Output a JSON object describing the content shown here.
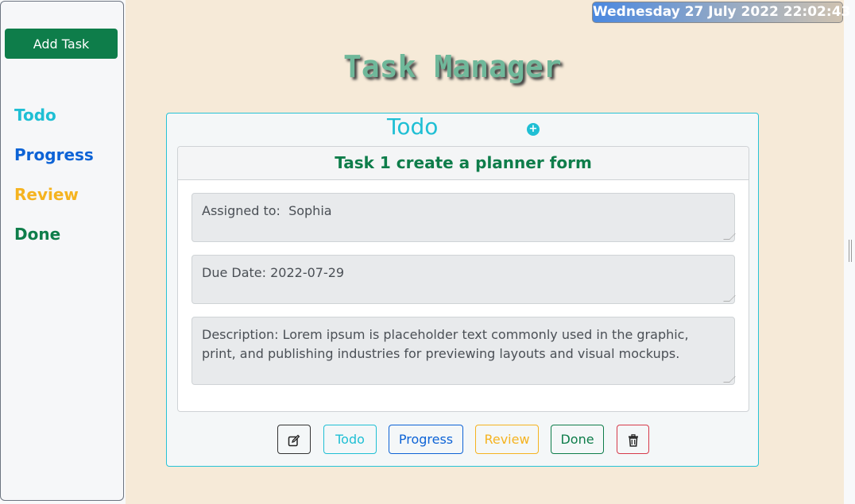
{
  "sidebar": {
    "add_task_label": "Add Task",
    "items": [
      {
        "label": "Todo",
        "color": "#1fbfd4"
      },
      {
        "label": "Progress",
        "color": "#0d63d6"
      },
      {
        "label": "Review",
        "color": "#f5b320"
      },
      {
        "label": "Done",
        "color": "#0e7d4a"
      }
    ]
  },
  "header": {
    "datetime": "Wednesday 27 July 2022 22:02:43",
    "title": "Task Manager"
  },
  "column": {
    "title": "Todo",
    "add_icon": "plus-circle-icon",
    "card": {
      "title": "Task 1 create a planner form",
      "assigned": "Assigned to:  Sophia",
      "due_date": "Due Date: 2022-07-29",
      "description": "Description: Lorem ipsum is placeholder text commonly used in the graphic, print, and publishing industries for previewing layouts and visual mockups."
    },
    "actions": {
      "edit_icon": "edit-icon",
      "todo": "Todo",
      "progress": "Progress",
      "review": "Review",
      "done": "Done",
      "delete_icon": "trash-icon"
    }
  }
}
